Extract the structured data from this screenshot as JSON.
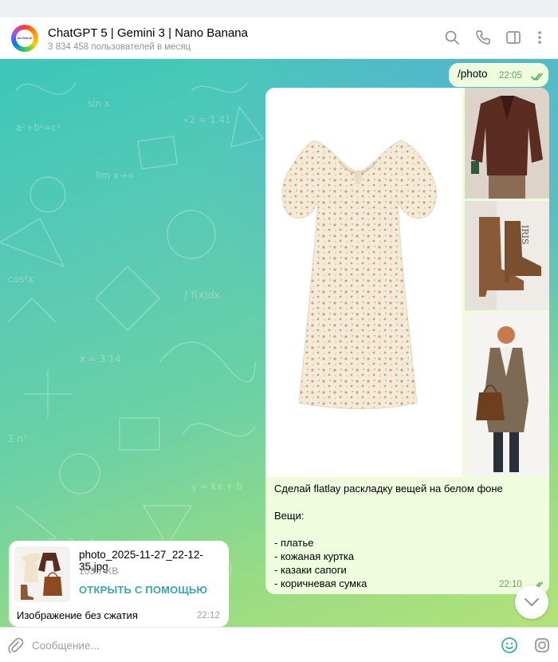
{
  "header": {
    "avatar_text": "All-Seti AI",
    "title": "ChatGPT 5 | Gemini 3 | Nano Banana",
    "subtitle": "3 834 458 пользователей в месяц",
    "icons": [
      "search-icon",
      "phone-icon",
      "sidebar-toggle-icon",
      "more-vertical-icon"
    ]
  },
  "messages": {
    "command": {
      "text": "/photo",
      "time": "22:05",
      "status": "read"
    },
    "media_message": {
      "photos": [
        "floral-dress",
        "leather-jacket",
        "cowboy-boots",
        "brown-tote-bag-outfit"
      ],
      "side_label": "IRIS",
      "lines": [
        "Сделай flatlay раскладку вещей на белом фоне",
        "",
        "Вещи:",
        "",
        "- платье",
        "- кожаная куртка",
        "- казаки сапоги",
        "- коричневая сумка"
      ],
      "time": "22:10",
      "status": "read"
    },
    "file_message": {
      "file_name": "photo_2025-11-27_22-12-35.jpg",
      "file_size": "103.7 KB",
      "open_label": "ОТКРЫТЬ С ПОМОЩЬЮ",
      "caption": "Изображение без сжатия",
      "time": "22:12"
    }
  },
  "input": {
    "placeholder": "Сообщение...",
    "value": ""
  },
  "colors": {
    "outgoing_bubble": "#effdde",
    "incoming_bubble": "#ffffff",
    "accent": "#3aa6a8",
    "read_checks": "#55a860"
  }
}
